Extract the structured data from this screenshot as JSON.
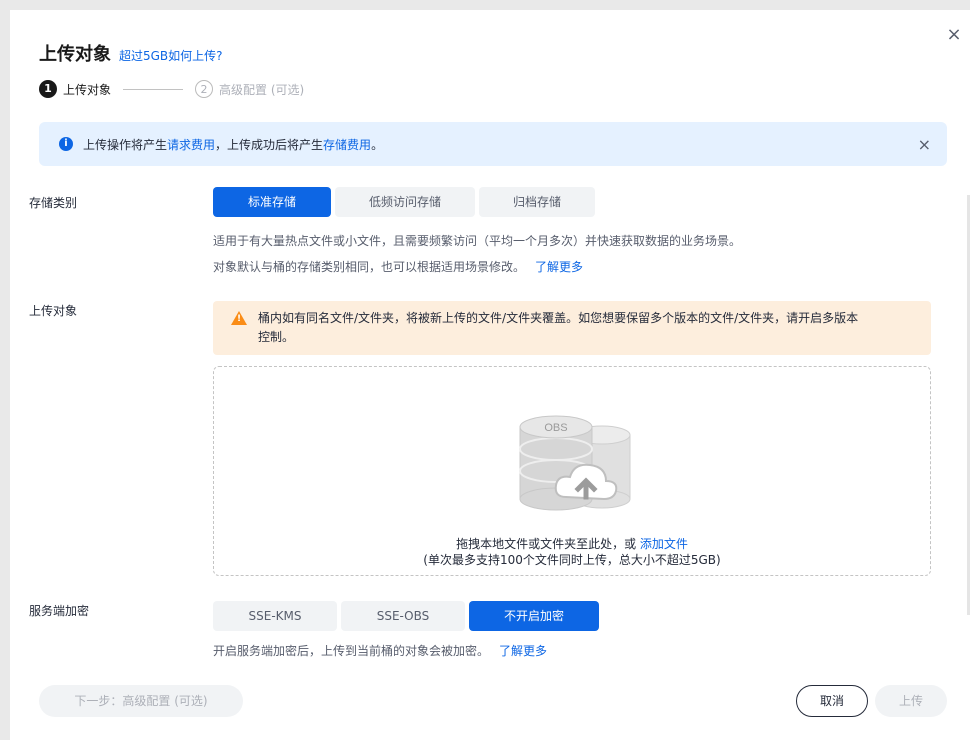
{
  "dialog": {
    "title": "上传对象",
    "title_link": "超过5GB如何上传?",
    "close_icon": "×"
  },
  "steps": [
    {
      "num": "1",
      "label": "上传对象"
    },
    {
      "num": "2",
      "label": "高级配置 (可选)"
    }
  ],
  "info": {
    "icon": "i",
    "text_1": "上传操作将产生",
    "link_1": "请求费用",
    "text_2": "，上传成功后将产生",
    "link_2": "存储费用",
    "text_3": "。",
    "close": "×"
  },
  "storage": {
    "label": "存储类别",
    "options": [
      "标准存储",
      "低频访问存储",
      "归档存储"
    ],
    "selected": "标准存储",
    "desc_1": "适用于有大量热点文件或小文件，且需要频繁访问（平均一个月多次）并快速获取数据的业务场景。",
    "desc_2": "对象默认与桶的存储类别相同，也可以根据适用场景修改。",
    "learn_more": "了解更多"
  },
  "upload": {
    "label": "上传对象",
    "warning_1": "桶内如有同名文件/文件夹，将被新上传的文件/文件夹覆盖。如您想要保留多个版本的文件/文件夹，请开启多版本",
    "warning_2": "控制。",
    "illus_label": "OBS",
    "drop_text": "拖拽本地文件或文件夹至此处，或",
    "drop_link": "添加文件",
    "drop_hint": "(单次最多支持100个文件同时上传，总大小不超过5GB)"
  },
  "encryption": {
    "label": "服务端加密",
    "options": [
      "SSE-KMS",
      "SSE-OBS",
      "不开启加密"
    ],
    "selected": "不开启加密",
    "desc": "开启服务端加密后，上传到当前桶的对象会被加密。",
    "learn_more": "了解更多"
  },
  "footer": {
    "next": "下一步：高级配置 (可选)",
    "cancel": "取消",
    "upload": "上传"
  },
  "colors": {
    "accent": "#0d66e4",
    "info_bg": "#e5f1ff",
    "warn_bg": "#fdeedd",
    "warn_icon": "#fa8c16"
  }
}
